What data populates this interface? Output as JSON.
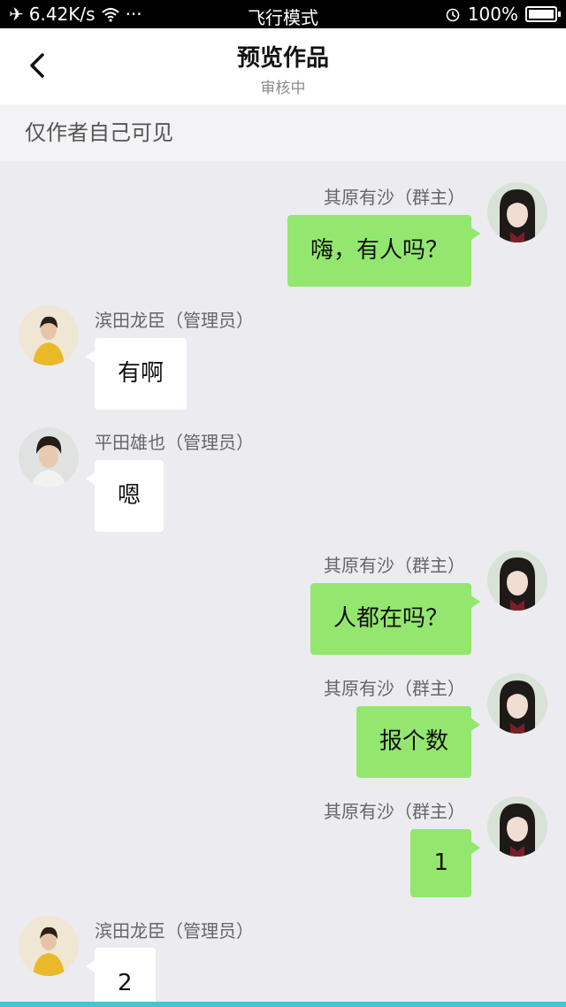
{
  "status_bar": {
    "network_speed": "6.42K/s",
    "more": "···",
    "mode": "飞行模式",
    "battery": "100%"
  },
  "header": {
    "title": "预览作品",
    "subtitle": "审核中"
  },
  "notice": "仅作者自己可见",
  "messages": [
    {
      "side": "right",
      "name": "其原有沙（群主）",
      "text": "嗨，有人吗？"
    },
    {
      "side": "left",
      "name": "滨田龙臣（管理员）",
      "text": "有啊"
    },
    {
      "side": "left",
      "name": "平田雄也（管理员）",
      "text": "嗯"
    },
    {
      "side": "right",
      "name": "其原有沙（群主）",
      "text": "人都在吗？"
    },
    {
      "side": "right",
      "name": "其原有沙（群主）",
      "text": "报个数"
    },
    {
      "side": "right",
      "name": "其原有沙（群主）",
      "text": "1"
    },
    {
      "side": "left",
      "name": "滨田龙臣（管理员）",
      "text": "2"
    }
  ],
  "colors": {
    "outgoing_bubble": "#93e76e",
    "incoming_bubble": "#ffffff",
    "chat_background": "#ebebf0",
    "accent_bar": "#41c7d6"
  }
}
